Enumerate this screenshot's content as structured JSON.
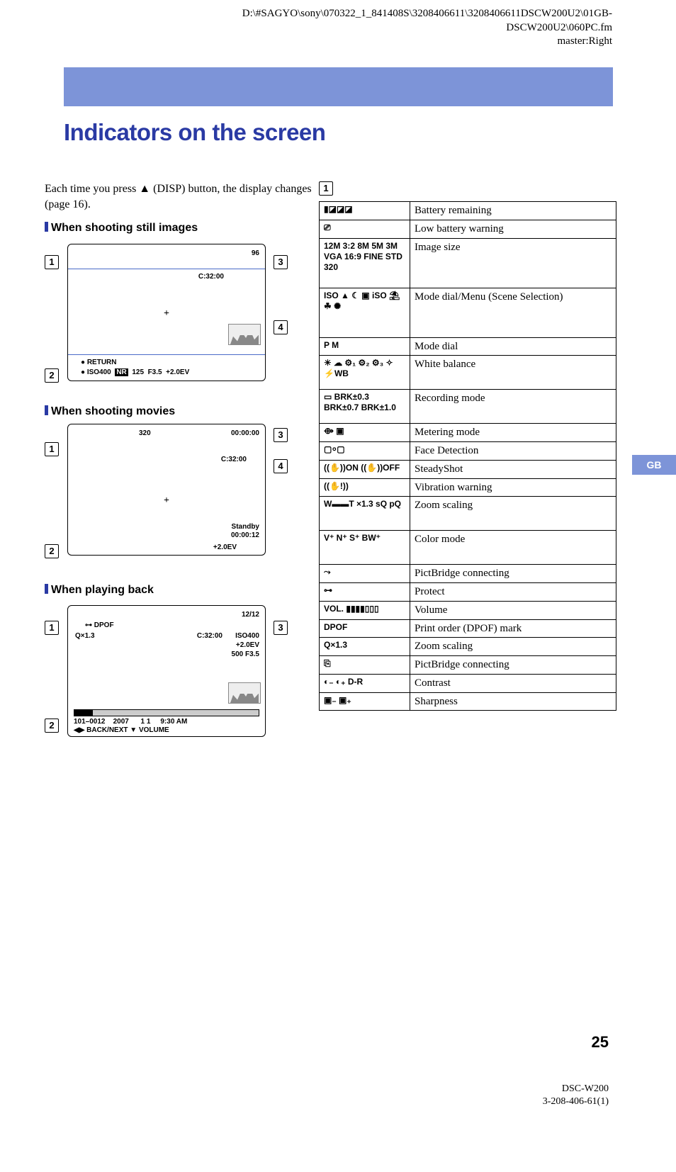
{
  "header": {
    "path_line1": "D:\\#SAGYO\\sony\\070322_1_841408S\\3208406611\\3208406611DSCW200U2\\01GB-",
    "path_line2": "DSCW200U2\\060PC.fm",
    "path_line3": "master:Right"
  },
  "title": "Indicators on the screen",
  "intro": "Each time you press ▲ (DISP) button, the display changes (page 16).",
  "sections": {
    "still": "When shooting still images",
    "movies": "When shooting movies",
    "playback": "When playing back"
  },
  "callouts": {
    "c1": "1",
    "c2": "2",
    "c3": "3",
    "c4": "4"
  },
  "dia1": {
    "count": "96",
    "time": "C:32:00",
    "return": "RETURN",
    "iso": "ISO400",
    "nr": "NR",
    "shutter": "125",
    "f": "F3.5",
    "ev": "+2.0EV"
  },
  "dia2": {
    "size": "320",
    "rectime": "00:00:00",
    "time": "C:32:00",
    "standby": "Standby",
    "standbytime": "00:00:12",
    "ev": "+2.0EV"
  },
  "dia3": {
    "frame": "12/12",
    "dpof": "DPOF",
    "zoom": "×1.3",
    "time": "C:32:00",
    "iso": "ISO400",
    "ev": "+2.0EV",
    "exp": "500  F3.5",
    "file": "101–0012",
    "year": "2007",
    "date": "1  1",
    "clock": "9:30  AM",
    "nav": "◀▶ BACK/NEXT    ▼ VOLUME"
  },
  "table": [
    {
      "icon": "▮◪◪◪",
      "desc": "Battery remaining"
    },
    {
      "icon": "⎚",
      "desc": "Low battery warning"
    },
    {
      "icon": "12M 3:2 8M 5M 3M VGA 16:9 FINE STD 320",
      "desc": "Image size"
    },
    {
      "icon": "ISO ▲ ☾ ▣ iSO ⛱ ☘ ✺",
      "desc": "Mode dial/Menu (Scene Selection)"
    },
    {
      "icon": "P  M",
      "desc": "Mode dial"
    },
    {
      "icon": "☀ ☁ ⚙₁ ⚙₂ ⚙₃ ✧ ⚡WB",
      "desc": "White balance"
    },
    {
      "icon": "▭ BRK±0.3 BRK±0.7 BRK±1.0",
      "desc": "Recording mode"
    },
    {
      "icon": "⟴ ▣",
      "desc": "Metering mode"
    },
    {
      "icon": "▢⸰▢",
      "desc": "Face Detection"
    },
    {
      "icon": "((✋))ON ((✋))OFF",
      "desc": "SteadyShot"
    },
    {
      "icon": "((✋!))",
      "desc": "Vibration warning"
    },
    {
      "icon": "W▬▬T  ×1.3 sQ pQ",
      "desc": "Zoom scaling"
    },
    {
      "icon": "V⁺ N⁺ S⁺ BW⁺",
      "desc": "Color mode"
    },
    {
      "icon": "⤳",
      "desc": "PictBridge connecting"
    },
    {
      "icon": "⊶",
      "desc": "Protect"
    },
    {
      "icon": "VOL. ▮▮▮▮▯▯▯",
      "desc": "Volume"
    },
    {
      "icon": "DPOF",
      "desc": "Print order (DPOF) mark"
    },
    {
      "icon": "Q×1.3",
      "desc": "Zoom scaling"
    },
    {
      "icon": "⎘",
      "desc": "PictBridge connecting"
    },
    {
      "icon": "◐₋ ◐₊ D-R",
      "desc": "Contrast"
    },
    {
      "icon": "▣₋ ▣₊",
      "desc": "Sharpness"
    }
  ],
  "gb_tab": "GB",
  "page_number": "25",
  "footer": {
    "model": "DSC-W200",
    "doc": "3-208-406-61(1)"
  }
}
